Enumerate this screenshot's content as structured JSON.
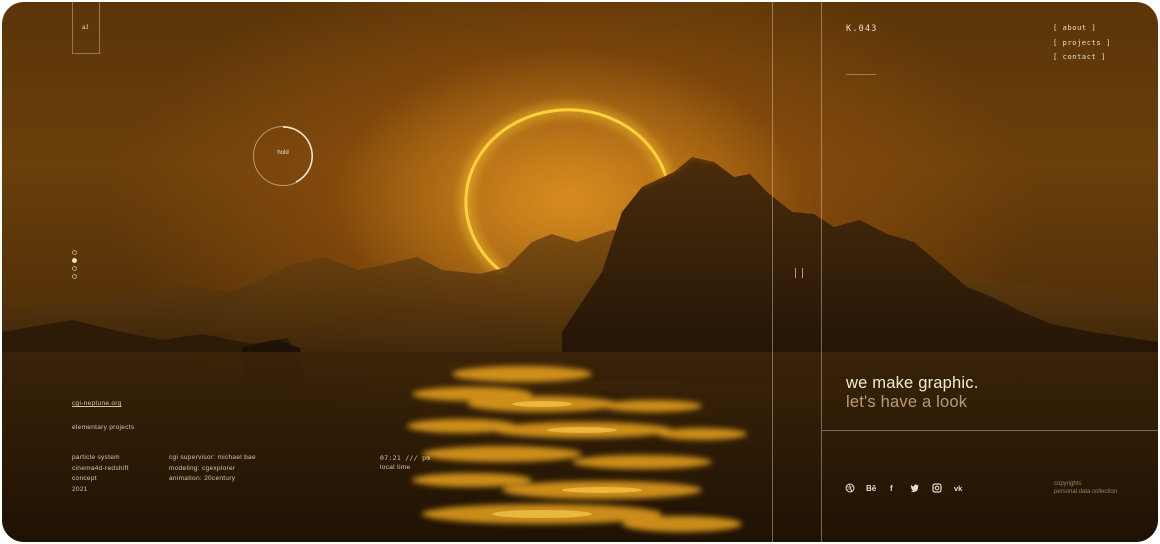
{
  "logo": {
    "mark": "a1"
  },
  "hold": {
    "label": "hold"
  },
  "site": {
    "link": "cgi-neptune.org",
    "subtitle": "elementary projects"
  },
  "credits_left": [
    "particle system",
    "cinema4d-redshift",
    "concept",
    "2021"
  ],
  "credits_right": [
    "cgi supervisor: michael bae",
    "modeling: cgexplorer",
    "animation: 20century"
  ],
  "clock": {
    "time": "07:21",
    "sep": "///",
    "ampm": "pm",
    "label": "local time"
  },
  "project_code": "K.043",
  "nav": [
    "[ about ]",
    "[ projects ]",
    "[ contact ]"
  ],
  "headline": {
    "line1": "we make graphic.",
    "line2": "let's have a look"
  },
  "social": [
    "dribbble-icon",
    "Bē",
    "f",
    "twitter-icon",
    "instagram-icon",
    "vk"
  ],
  "footer": {
    "copyrights": "copyrights",
    "privacy": "personal data collection"
  },
  "slider": {
    "count": 4,
    "active_index": 1
  },
  "colors": {
    "ring": "#ffd23a",
    "accent_text": "#b79c74",
    "sky": "#6a3f0b",
    "water": "#241505"
  }
}
